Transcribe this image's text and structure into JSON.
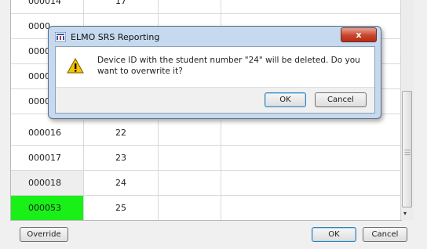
{
  "grid": {
    "rows": [
      {
        "id": "000014",
        "num": "17",
        "style": "partial"
      },
      {
        "id": "0000",
        "num": "",
        "style": "normal"
      },
      {
        "id": "0000",
        "num": "",
        "style": "normal"
      },
      {
        "id": "0000",
        "num": "",
        "style": "normal"
      },
      {
        "id": "0000",
        "num": "",
        "style": "normal"
      },
      {
        "id": "000016",
        "num": "22",
        "style": "normal"
      },
      {
        "id": "000017",
        "num": "23",
        "style": "normal"
      },
      {
        "id": "000018",
        "num": "24",
        "style": "gray"
      },
      {
        "id": "000053",
        "num": "25",
        "style": "green"
      }
    ]
  },
  "buttons": {
    "override": "Override",
    "ok": "OK",
    "cancel": "Cancel"
  },
  "dialog": {
    "title": "ELMO SRS Reporting",
    "close_label": "x",
    "message": "Device ID with the student number \"24\" will be deleted. Do you want to overwrite it?",
    "ok": "OK",
    "cancel": "Cancel"
  },
  "colors": {
    "highlight_green": "#18f018",
    "gray_cell": "#eeeeee"
  }
}
